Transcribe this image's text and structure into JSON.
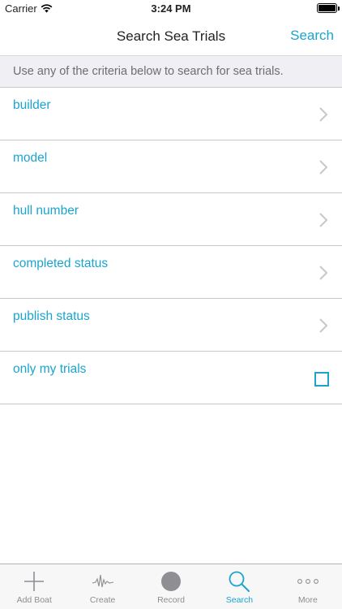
{
  "status_bar": {
    "carrier": "Carrier",
    "time": "3:24 PM"
  },
  "nav": {
    "title": "Search Sea Trials",
    "search_label": "Search"
  },
  "info": {
    "text": "Use any of the criteria below to search for sea trials."
  },
  "criteria": {
    "builder": "builder",
    "model": "model",
    "hull_number": "hull number",
    "completed_status": "completed status",
    "publish_status": "publish status",
    "only_my_trials": "only my trials"
  },
  "only_my_trials_checked": false,
  "tabs": {
    "add_boat": "Add Boat",
    "create": "Create",
    "record": "Record",
    "search": "Search",
    "more": "More"
  },
  "active_tab": "Search",
  "colors": {
    "accent": "#1aa5cf",
    "inactive": "#8e8e93",
    "banner_bg": "#efeff4"
  }
}
